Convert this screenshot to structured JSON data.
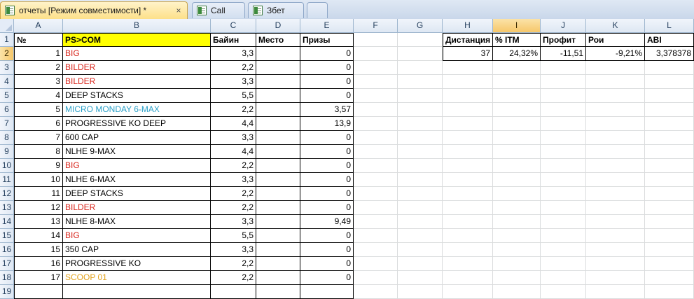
{
  "tabs": [
    {
      "label": "отчеты  [Режим совместимости] *",
      "close": "×",
      "active": true
    },
    {
      "label": "Call",
      "active": false
    },
    {
      "label": "Збет",
      "active": false
    },
    {
      "label": "",
      "active": false
    }
  ],
  "columns": [
    "A",
    "B",
    "C",
    "D",
    "E",
    "F",
    "G",
    "H",
    "I",
    "J",
    "K",
    "L"
  ],
  "selected_column": "I",
  "selected_row": "2",
  "row_numbers": [
    "1",
    "2",
    "3",
    "4",
    "5",
    "6",
    "7",
    "8",
    "9",
    "10",
    "11",
    "12",
    "13",
    "14",
    "15",
    "16",
    "17",
    "18",
    "19"
  ],
  "colors": {
    "red": "#d9261c",
    "blue": "#2aa0c8",
    "orange": "#e3a21a",
    "header_yellow": "#ffff00"
  },
  "table_headers": [
    "№",
    "PS>COM",
    "Байин",
    "Место",
    "Призы"
  ],
  "rows": [
    {
      "n": "1",
      "name": "BIG",
      "color": "red",
      "buyin": "3,3",
      "place": "",
      "prize": "0"
    },
    {
      "n": "2",
      "name": "BILDER",
      "color": "red",
      "buyin": "2,2",
      "place": "",
      "prize": "0"
    },
    {
      "n": "3",
      "name": "BILDER",
      "color": "red",
      "buyin": "3,3",
      "place": "",
      "prize": "0"
    },
    {
      "n": "4",
      "name": "DEEP STACKS",
      "color": "black",
      "buyin": "5,5",
      "place": "",
      "prize": "0"
    },
    {
      "n": "5",
      "name": "MICRO MONDAY 6-MAX",
      "color": "blue",
      "buyin": "2,2",
      "place": "",
      "prize": "3,57"
    },
    {
      "n": "6",
      "name": "PROGRESSIVE KO DEEP",
      "color": "black",
      "buyin": "4,4",
      "place": "",
      "prize": "13,9"
    },
    {
      "n": "7",
      "name": "600 CAP",
      "color": "black",
      "buyin": "3,3",
      "place": "",
      "prize": "0"
    },
    {
      "n": "8",
      "name": "NLHE 9-MAX",
      "color": "black",
      "buyin": "4,4",
      "place": "",
      "prize": "0"
    },
    {
      "n": "9",
      "name": "BIG",
      "color": "red",
      "buyin": "2,2",
      "place": "",
      "prize": "0"
    },
    {
      "n": "10",
      "name": "NLHE 6-MAX",
      "color": "black",
      "buyin": "3,3",
      "place": "",
      "prize": "0"
    },
    {
      "n": "11",
      "name": "DEEP STACKS",
      "color": "black",
      "buyin": "2,2",
      "place": "",
      "prize": "0"
    },
    {
      "n": "12",
      "name": "BILDER",
      "color": "red",
      "buyin": "2,2",
      "place": "",
      "prize": "0"
    },
    {
      "n": "13",
      "name": "NLHE 8-MAX",
      "color": "black",
      "buyin": "3,3",
      "place": "",
      "prize": "9,49"
    },
    {
      "n": "14",
      "name": "BIG",
      "color": "red",
      "buyin": "5,5",
      "place": "",
      "prize": "0"
    },
    {
      "n": "15",
      "name": "350 CAP",
      "color": "black",
      "buyin": "3,3",
      "place": "",
      "prize": "0"
    },
    {
      "n": "16",
      "name": "PROGRESSIVE KO",
      "color": "black",
      "buyin": "2,2",
      "place": "",
      "prize": "0"
    },
    {
      "n": "17",
      "name": "SCOOP 01",
      "color": "orange",
      "buyin": "2,2",
      "place": "",
      "prize": "0"
    }
  ],
  "stats": {
    "headers": [
      "Дистанция",
      "% ITM",
      "Профит",
      "Рои",
      "ABI"
    ],
    "values": [
      "37",
      "24,32%",
      "-11,51",
      "-9,21%",
      "3,378378"
    ]
  }
}
